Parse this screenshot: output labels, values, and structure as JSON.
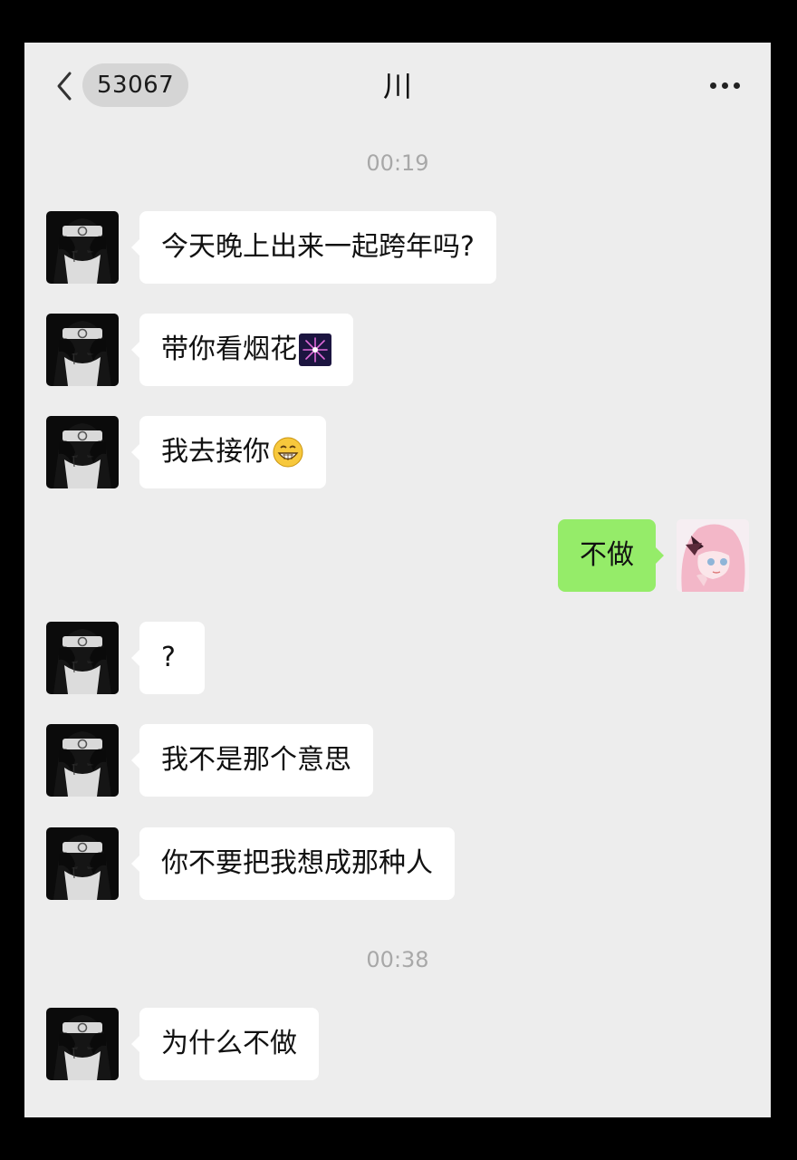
{
  "header": {
    "back_icon": "chevron-left-icon",
    "unread_count": "53067",
    "title": "川",
    "more_icon": "more-dots-icon"
  },
  "timestamps": [
    "00:19",
    "00:38"
  ],
  "messages": [
    {
      "side": "left",
      "text": "今天晚上出来一起跨年吗?",
      "avatar": "dark-anime-avatar"
    },
    {
      "side": "left",
      "text": "带你看烟花",
      "emoji": "fireworks-emoji",
      "avatar": "dark-anime-avatar"
    },
    {
      "side": "left",
      "text": "我去接你",
      "emoji": "grin-emoji",
      "avatar": "dark-anime-avatar"
    },
    {
      "side": "right",
      "text": "不做",
      "avatar": "pink-hair-anime-avatar"
    },
    {
      "side": "left",
      "text": "?",
      "avatar": "dark-anime-avatar"
    },
    {
      "side": "left",
      "text": "我不是那个意思",
      "avatar": "dark-anime-avatar"
    },
    {
      "side": "left",
      "text": "你不要把我想成那种人",
      "avatar": "dark-anime-avatar"
    },
    {
      "side": "left",
      "text": "为什么不做",
      "avatar": "dark-anime-avatar"
    }
  ],
  "colors": {
    "background": "#ededed",
    "incoming_bubble": "#ffffff",
    "outgoing_bubble": "#95ec69",
    "timestamp": "#a8a8a8"
  }
}
